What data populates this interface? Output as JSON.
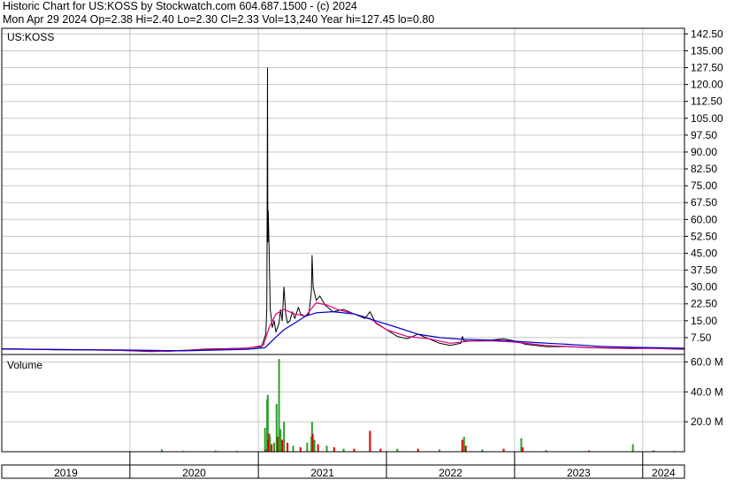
{
  "header": {
    "line1": "Historic Chart for US:KOSS by Stockwatch.com 604.687.1500 - (c) 2024",
    "line2": "Mon Apr 29 2024   Op=2.38   Hi=2.40   Lo=2.30   Cl=2.33   Vol=13,240   Year hi=127.45   lo=0.80"
  },
  "colors": {
    "price": "#000000",
    "ma_short": "#e0007a",
    "ma_long": "#0000c8",
    "vol_up": "#2aa02a",
    "vol_down": "#dd0000",
    "grid": "#c8c8c8"
  },
  "chart_data": [
    {
      "type": "line",
      "title": "US:KOSS",
      "ylim": [
        0,
        145
      ],
      "yticks": [
        "7.50",
        "15.00",
        "22.50",
        "30.00",
        "37.50",
        "45.00",
        "52.50",
        "60.00",
        "67.50",
        "75.00",
        "82.50",
        "90.00",
        "97.50",
        "105.00",
        "112.50",
        "120.00",
        "127.50",
        "135.00",
        "142.50"
      ],
      "x_years": [
        "2019",
        "2020",
        "2021",
        "2022",
        "2023",
        "2024"
      ],
      "x_range": [
        "2019-01-01",
        "2024-04-29"
      ],
      "series": [
        {
          "style": "price",
          "points": [
            [
              "2019-01-01",
              2.6
            ],
            [
              "2019-03-01",
              2.4
            ],
            [
              "2019-06-01",
              2.1
            ],
            [
              "2019-09-01",
              2.0
            ],
            [
              "2019-12-01",
              1.8
            ],
            [
              "2020-03-01",
              1.3
            ],
            [
              "2020-05-01",
              1.5
            ],
            [
              "2020-08-01",
              2.4
            ],
            [
              "2020-10-01",
              2.6
            ],
            [
              "2020-12-01",
              2.9
            ],
            [
              "2021-01-10",
              3.5
            ],
            [
              "2021-01-22",
              9.0
            ],
            [
              "2021-01-25",
              20
            ],
            [
              "2021-01-26",
              64
            ],
            [
              "2021-01-27",
              127.45
            ],
            [
              "2021-01-28",
              50
            ],
            [
              "2021-01-29",
              64
            ],
            [
              "2021-02-01",
              45
            ],
            [
              "2021-02-04",
              20
            ],
            [
              "2021-02-10",
              12
            ],
            [
              "2021-02-15",
              15
            ],
            [
              "2021-02-20",
              10
            ],
            [
              "2021-03-01",
              14
            ],
            [
              "2021-03-05",
              20
            ],
            [
              "2021-03-10",
              15
            ],
            [
              "2021-03-15",
              30
            ],
            [
              "2021-03-20",
              18
            ],
            [
              "2021-03-25",
              14
            ],
            [
              "2021-04-01",
              15
            ],
            [
              "2021-04-08",
              19
            ],
            [
              "2021-04-15",
              16
            ],
            [
              "2021-04-25",
              21
            ],
            [
              "2021-05-01",
              18
            ],
            [
              "2021-05-15",
              17
            ],
            [
              "2021-05-25",
              18
            ],
            [
              "2021-06-01",
              28
            ],
            [
              "2021-06-03",
              44
            ],
            [
              "2021-06-06",
              30
            ],
            [
              "2021-06-15",
              24
            ],
            [
              "2021-06-25",
              26
            ],
            [
              "2021-07-10",
              22
            ],
            [
              "2021-08-01",
              19
            ],
            [
              "2021-09-01",
              20
            ],
            [
              "2021-10-01",
              18
            ],
            [
              "2021-11-01",
              16
            ],
            [
              "2021-11-15",
              19
            ],
            [
              "2021-12-01",
              14
            ],
            [
              "2022-01-01",
              11
            ],
            [
              "2022-02-01",
              8
            ],
            [
              "2022-03-01",
              7
            ],
            [
              "2022-04-01",
              9
            ],
            [
              "2022-05-01",
              7
            ],
            [
              "2022-06-01",
              5
            ],
            [
              "2022-07-01",
              4
            ],
            [
              "2022-08-01",
              5
            ],
            [
              "2022-08-05",
              8
            ],
            [
              "2022-08-10",
              6
            ],
            [
              "2022-09-01",
              6
            ],
            [
              "2022-10-01",
              6
            ],
            [
              "2022-11-01",
              6.5
            ],
            [
              "2022-12-01",
              7
            ],
            [
              "2023-01-01",
              6
            ],
            [
              "2023-02-01",
              4.5
            ],
            [
              "2023-04-01",
              3.5
            ],
            [
              "2023-06-01",
              3.5
            ],
            [
              "2023-08-01",
              3.0
            ],
            [
              "2023-10-01",
              2.8
            ],
            [
              "2023-12-01",
              2.6
            ],
            [
              "2024-02-01",
              2.8
            ],
            [
              "2024-03-01",
              2.5
            ],
            [
              "2024-04-29",
              2.33
            ]
          ]
        },
        {
          "style": "ma_short",
          "points": [
            [
              "2019-01-01",
              2.5
            ],
            [
              "2019-06-01",
              2.2
            ],
            [
              "2019-12-01",
              1.8
            ],
            [
              "2020-04-01",
              1.4
            ],
            [
              "2020-08-01",
              2.2
            ],
            [
              "2020-12-01",
              2.8
            ],
            [
              "2021-01-15",
              4
            ],
            [
              "2021-02-01",
              12
            ],
            [
              "2021-02-20",
              18
            ],
            [
              "2021-03-15",
              20
            ],
            [
              "2021-04-15",
              18
            ],
            [
              "2021-05-15",
              17
            ],
            [
              "2021-06-15",
              23
            ],
            [
              "2021-07-15",
              22
            ],
            [
              "2021-08-15",
              20
            ],
            [
              "2021-10-01",
              18
            ],
            [
              "2021-11-15",
              16
            ],
            [
              "2022-01-01",
              11
            ],
            [
              "2022-03-01",
              8
            ],
            [
              "2022-05-01",
              7
            ],
            [
              "2022-07-01",
              5
            ],
            [
              "2022-09-01",
              6
            ],
            [
              "2022-11-01",
              6
            ],
            [
              "2023-01-01",
              5.5
            ],
            [
              "2023-04-01",
              4
            ],
            [
              "2023-08-01",
              3.1
            ],
            [
              "2023-12-01",
              2.8
            ],
            [
              "2024-04-29",
              2.5
            ]
          ]
        },
        {
          "style": "ma_long",
          "points": [
            [
              "2019-01-01",
              2.4
            ],
            [
              "2019-12-01",
              2.0
            ],
            [
              "2020-06-01",
              1.6
            ],
            [
              "2020-12-01",
              2.3
            ],
            [
              "2021-01-20",
              3.0
            ],
            [
              "2021-02-15",
              7
            ],
            [
              "2021-03-15",
              11
            ],
            [
              "2021-04-15",
              14
            ],
            [
              "2021-05-15",
              17
            ],
            [
              "2021-06-15",
              18.5
            ],
            [
              "2021-08-01",
              19
            ],
            [
              "2021-10-01",
              18
            ],
            [
              "2021-12-01",
              15
            ],
            [
              "2022-02-01",
              12
            ],
            [
              "2022-04-01",
              9
            ],
            [
              "2022-06-01",
              7.5
            ],
            [
              "2022-08-01",
              6.8
            ],
            [
              "2022-10-01",
              6.5
            ],
            [
              "2022-12-01",
              6.2
            ],
            [
              "2023-03-01",
              5.3
            ],
            [
              "2023-06-01",
              4.5
            ],
            [
              "2023-09-01",
              3.6
            ],
            [
              "2023-12-01",
              3.2
            ],
            [
              "2024-04-29",
              2.8
            ]
          ]
        }
      ]
    },
    {
      "type": "bar",
      "title": "Volume",
      "ylim": [
        0,
        65
      ],
      "yticks": [
        "20.0 M",
        "40.0 M",
        "60.0 M"
      ],
      "bars": [
        {
          "x": "2019-03-01",
          "v": 0.2,
          "up": true
        },
        {
          "x": "2019-08-01",
          "v": 0.3,
          "up": true
        },
        {
          "x": "2019-12-01",
          "v": 0.2,
          "up": true
        },
        {
          "x": "2020-04-01",
          "v": 1.5,
          "up": true
        },
        {
          "x": "2020-06-01",
          "v": 0.5,
          "up": false
        },
        {
          "x": "2020-09-01",
          "v": 0.8,
          "up": true
        },
        {
          "x": "2020-11-01",
          "v": 0.5,
          "up": false
        },
        {
          "x": "2021-01-20",
          "v": 16,
          "up": true
        },
        {
          "x": "2021-01-22",
          "v": 1.5,
          "up": false
        },
        {
          "x": "2021-01-26",
          "v": 35,
          "up": true
        },
        {
          "x": "2021-01-27",
          "v": 20,
          "up": true
        },
        {
          "x": "2021-01-28",
          "v": 38,
          "up": true
        },
        {
          "x": "2021-01-29",
          "v": 8,
          "up": false
        },
        {
          "x": "2021-02-01",
          "v": 12,
          "up": false
        },
        {
          "x": "2021-02-03",
          "v": 10,
          "up": true
        },
        {
          "x": "2021-02-08",
          "v": 5,
          "up": false
        },
        {
          "x": "2021-02-15",
          "v": 6,
          "up": true
        },
        {
          "x": "2021-02-22",
          "v": 32,
          "up": true
        },
        {
          "x": "2021-02-25",
          "v": 10,
          "up": false
        },
        {
          "x": "2021-03-01",
          "v": 62,
          "up": true
        },
        {
          "x": "2021-03-05",
          "v": 15,
          "up": true
        },
        {
          "x": "2021-03-10",
          "v": 8,
          "up": false
        },
        {
          "x": "2021-03-15",
          "v": 20,
          "up": true
        },
        {
          "x": "2021-03-25",
          "v": 6,
          "up": false
        },
        {
          "x": "2021-04-10",
          "v": 4,
          "up": true
        },
        {
          "x": "2021-05-01",
          "v": 3,
          "up": false
        },
        {
          "x": "2021-05-20",
          "v": 6,
          "up": true
        },
        {
          "x": "2021-06-01",
          "v": 10,
          "up": true
        },
        {
          "x": "2021-06-03",
          "v": 20,
          "up": true
        },
        {
          "x": "2021-06-05",
          "v": 12,
          "up": false
        },
        {
          "x": "2021-06-10",
          "v": 8,
          "up": true
        },
        {
          "x": "2021-06-20",
          "v": 5,
          "up": false
        },
        {
          "x": "2021-07-15",
          "v": 4,
          "up": true
        },
        {
          "x": "2021-08-05",
          "v": 3,
          "up": false
        },
        {
          "x": "2021-09-01",
          "v": 2,
          "up": true
        },
        {
          "x": "2021-10-01",
          "v": 2,
          "up": false
        },
        {
          "x": "2021-11-15",
          "v": 14,
          "up": false
        },
        {
          "x": "2021-12-15",
          "v": 2,
          "up": false
        },
        {
          "x": "2022-02-01",
          "v": 2,
          "up": true
        },
        {
          "x": "2022-04-01",
          "v": 2,
          "up": false
        },
        {
          "x": "2022-06-01",
          "v": 1.5,
          "up": true
        },
        {
          "x": "2022-08-05",
          "v": 8,
          "up": false
        },
        {
          "x": "2022-08-10",
          "v": 10,
          "up": true
        },
        {
          "x": "2022-08-15",
          "v": 4,
          "up": false
        },
        {
          "x": "2022-10-01",
          "v": 1.5,
          "up": true
        },
        {
          "x": "2022-12-01",
          "v": 2,
          "up": false
        },
        {
          "x": "2023-01-20",
          "v": 9,
          "up": true
        },
        {
          "x": "2023-01-24",
          "v": 3,
          "up": false
        },
        {
          "x": "2023-04-01",
          "v": 1,
          "up": true
        },
        {
          "x": "2023-08-01",
          "v": 0.8,
          "up": false
        },
        {
          "x": "2023-12-04",
          "v": 5,
          "up": true
        },
        {
          "x": "2024-02-01",
          "v": 0.8,
          "up": false
        },
        {
          "x": "2024-04-01",
          "v": 0.5,
          "up": true
        }
      ]
    }
  ]
}
